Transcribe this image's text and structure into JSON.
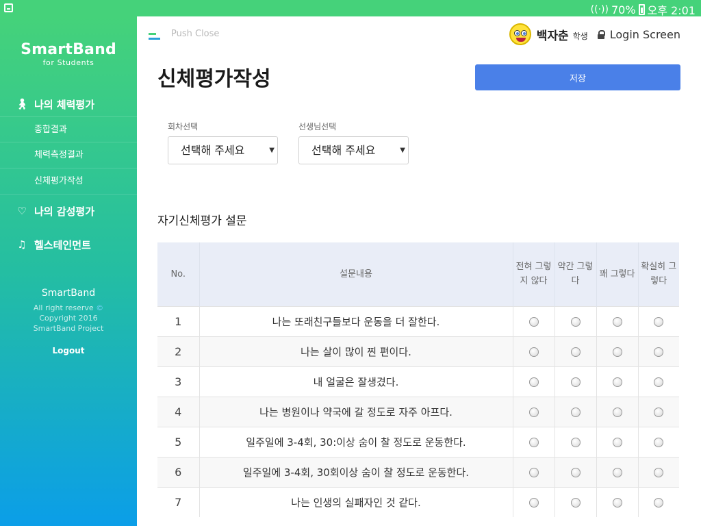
{
  "status_bar": {
    "battery_text": "70%",
    "time": "오후 2:01"
  },
  "sidebar": {
    "brand": "SmartBand",
    "brand_sub": "for Students",
    "menu": [
      {
        "label": "나의 체력평가",
        "icon": "walking-person-icon",
        "children": [
          "종합결과",
          "체력측정결과",
          "신체평가작성"
        ]
      },
      {
        "label": "나의 감성평가",
        "icon": "heartbeat-icon"
      },
      {
        "label": "헬스테인먼트",
        "icon": "music-note-icon"
      }
    ],
    "footer": {
      "name": "SmartBand",
      "rights": "All right reserve",
      "copyright": "Copyright 2016",
      "project": "SmartBand Project",
      "logout": "Logout"
    }
  },
  "header": {
    "push_close": "Push Close",
    "user_name": "백자춘",
    "user_role": "학생",
    "login_screen": "Login Screen"
  },
  "main": {
    "title": "신체평가작성",
    "save_label": "저장",
    "selects": [
      {
        "label": "회차선택",
        "value": "선택해 주세요"
      },
      {
        "label": "선생님선택",
        "value": "선택해 주세요"
      }
    ],
    "section_title": "자기신체평가 설문",
    "table": {
      "headers": [
        "No.",
        "설문내용",
        "전혀 그렇지 않다",
        "약간 그렇다",
        "꽤 그렇다",
        "확실히 그렇다"
      ],
      "rows": [
        {
          "no": "1",
          "text": "나는 또래친구들보다 운동을 더 잘한다."
        },
        {
          "no": "2",
          "text": "나는 살이 많이 찐 편이다."
        },
        {
          "no": "3",
          "text": "내 얼굴은 잘생겼다."
        },
        {
          "no": "4",
          "text": "나는 병원이나 약국에 갈 정도로 자주 아프다."
        },
        {
          "no": "5",
          "text": "일주일에 3-4회, 30:이상 숨이 찰 정도로 운동한다."
        },
        {
          "no": "6",
          "text": "일주일에 3-4회, 30회이상 숨이 찰 정도로 운동한다."
        },
        {
          "no": "7",
          "text": "나는 인생의 실패자인 것 같다."
        }
      ]
    }
  },
  "colors": {
    "accent": "#4a80e8",
    "sidebar_top": "#45d27a",
    "sidebar_bottom": "#0b9ee8"
  }
}
